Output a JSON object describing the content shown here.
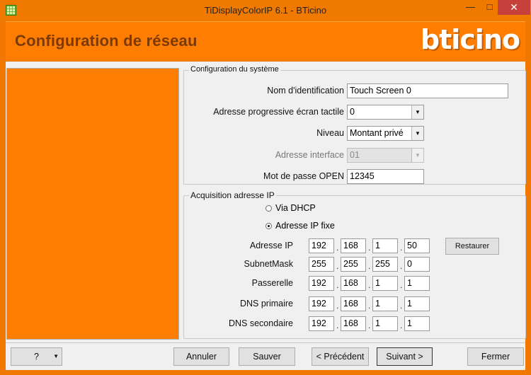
{
  "window": {
    "title": "TiDisplayColorIP 6.1 - BTicino",
    "minimize": "—",
    "maximize": "□",
    "close": "✕"
  },
  "header": {
    "page_title": "Configuration de réseau",
    "logo_text": "bticino"
  },
  "system_group": {
    "legend": "Configuration du système",
    "id_label": "Nom d'identification",
    "id_value": "Touch Screen 0",
    "address_label": "Adresse progressive écran tactile",
    "address_value": "0",
    "level_label": "Niveau",
    "level_value": "Montant privé",
    "interface_label": "Adresse interface",
    "interface_value": "01",
    "password_label": "Mot de passe OPEN",
    "password_value": "12345"
  },
  "ip_group": {
    "legend": "Acquisition adresse IP",
    "dhcp_label": "Via DHCP",
    "fixed_label": "Adresse IP fixe",
    "selected": "fixed",
    "rows": [
      {
        "label": "Adresse IP",
        "octets": [
          "192",
          "168",
          "1",
          "50"
        ]
      },
      {
        "label": "SubnetMask",
        "octets": [
          "255",
          "255",
          "255",
          "0"
        ]
      },
      {
        "label": "Passerelle",
        "octets": [
          "192",
          "168",
          "1",
          "1"
        ]
      },
      {
        "label": "DNS primaire",
        "octets": [
          "192",
          "168",
          "1",
          "1"
        ]
      },
      {
        "label": "DNS secondaire",
        "octets": [
          "192",
          "168",
          "1",
          "1"
        ]
      }
    ],
    "restore_label": "Restaurer"
  },
  "footer": {
    "help_label": "?",
    "cancel_label": "Annuler",
    "save_label": "Sauver",
    "prev_label": "< Précédent",
    "next_label": "Suivant >",
    "close_label": "Fermer"
  },
  "colors": {
    "brand_orange": "#ff7d00",
    "title_brown": "#7a3a08",
    "close_red": "#c7413c"
  }
}
